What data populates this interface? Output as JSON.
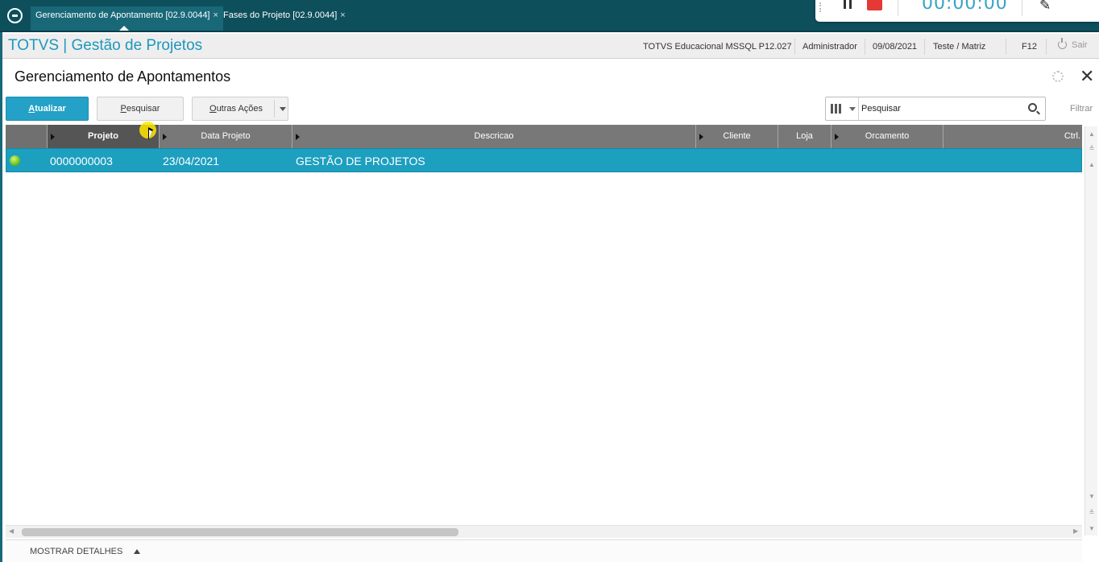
{
  "tabs": [
    {
      "label": "Gerenciamento de Apontamento [02.9.0044]",
      "close": "×"
    },
    {
      "label": "Fases do Projeto [02.9.0044]",
      "close": "×"
    }
  ],
  "recorder": {
    "time": "00:00:00"
  },
  "header": {
    "brand": "TOTVS | Gestão de Projetos",
    "environment": "TOTVS Educacional MSSQL P12.027",
    "user": "Administrador",
    "date": "09/08/2021",
    "branch": "Teste / Matriz",
    "shortcut": "F12",
    "exit_label": "Sair"
  },
  "page": {
    "title": "Gerenciamento de Apontamentos"
  },
  "toolbar": {
    "update_label_first": "A",
    "update_label_rest": "tualizar",
    "search_label_first": "P",
    "search_label_rest": "esquisar",
    "more_label_first": "O",
    "more_label_rest": "utras Ações",
    "filter_label": "Filtrar"
  },
  "search": {
    "placeholder": "Pesquisar"
  },
  "grid": {
    "columns": [
      "Projeto",
      "Data Projeto",
      "Descricao",
      "Cliente",
      "Loja",
      "Orcamento",
      "Ctrl."
    ],
    "rows": [
      {
        "projeto": "0000000003",
        "data": "23/04/2021",
        "descricao": "GESTÃO DE PROJETOS",
        "status_color": "#6cc31c"
      }
    ]
  },
  "footer": {
    "details_label": "MOSTRAR DETALHES"
  },
  "colors": {
    "accent": "#1d9fbf",
    "tabbar": "#0e4f5c",
    "brand": "#1d97bd"
  },
  "icons": [
    "app-logo-icon",
    "pause-icon",
    "stop-icon",
    "pen-icon",
    "power-icon",
    "gear-icon",
    "close-icon",
    "columns-icon",
    "search-icon",
    "status-green-icon"
  ]
}
